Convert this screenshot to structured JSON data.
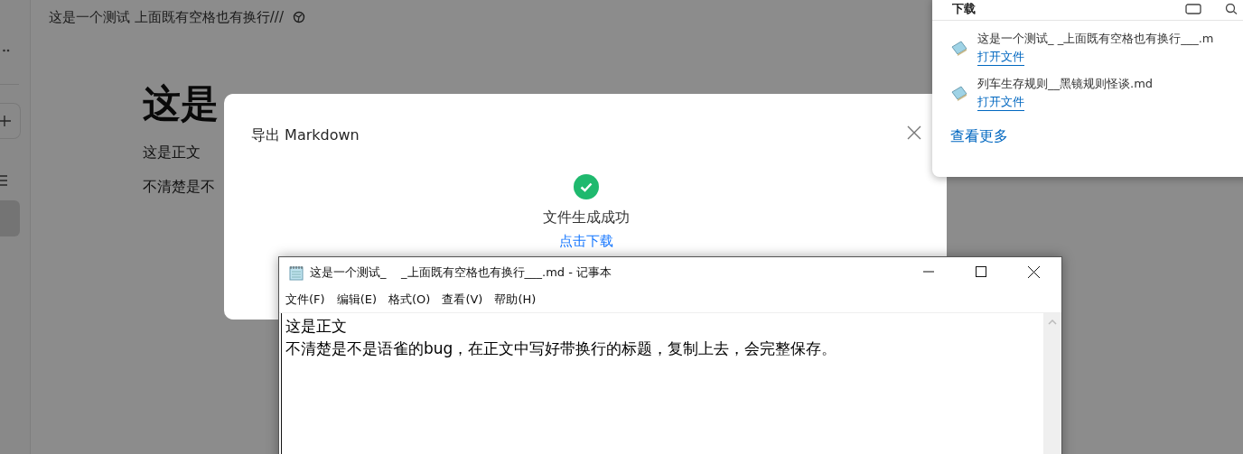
{
  "doc_header": {
    "title": "这是一个测试 上面既有空格也有换行///"
  },
  "document": {
    "heading": "这是",
    "paragraphs": [
      "这是正文",
      "不清楚是不"
    ]
  },
  "export_dialog": {
    "title": "导出 Markdown",
    "message": "文件生成成功",
    "link": "点击下载"
  },
  "downloads": {
    "title": "下载",
    "items": [
      {
        "filename": "这是一个测试_ _上面既有空格也有换行___.m",
        "action": "打开文件"
      },
      {
        "filename": "列车生存规则__黑镜规则怪谈.md",
        "action": "打开文件"
      }
    ],
    "more": "查看更多"
  },
  "notepad": {
    "title": "这是一个测试_    _上面既有空格也有换行___.md - 记事本",
    "menu": [
      "文件(F)",
      "编辑(E)",
      "格式(O)",
      "查看(V)",
      "帮助(H)"
    ],
    "lines": [
      "这是正文",
      "不清楚是不是语雀的bug，在正文中写好带换行的标题，复制上去，会完整保存。"
    ]
  }
}
